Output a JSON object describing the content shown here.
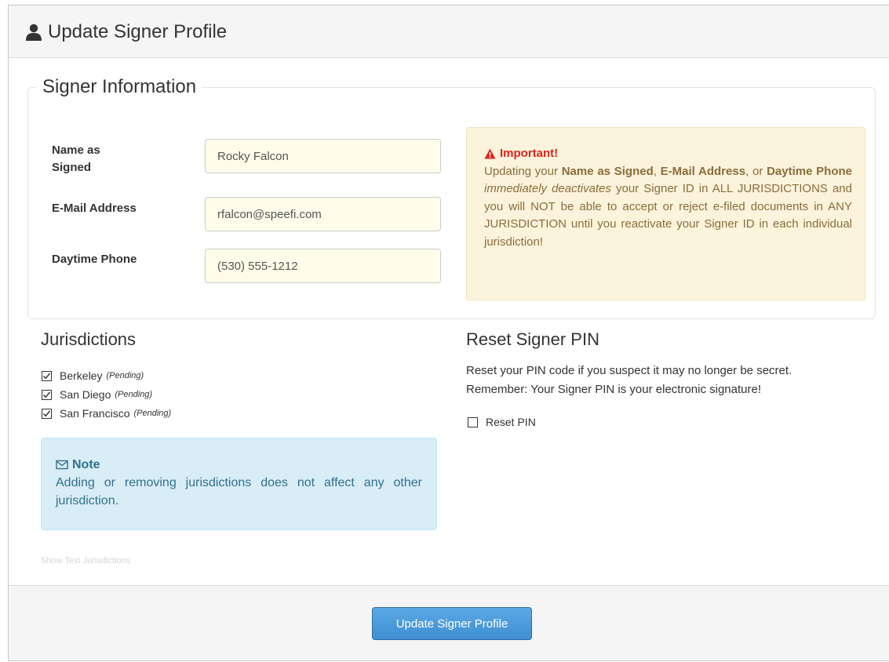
{
  "header": {
    "title": "Update Signer Profile",
    "icon": "user-icon"
  },
  "signer_info": {
    "legend": "Signer Information",
    "name": {
      "label_line1": "Name as",
      "label_line2": "Signed",
      "value": "Rocky Falcon"
    },
    "email": {
      "label": "E-Mail Address",
      "value": "rfalcon@speefi.com"
    },
    "phone": {
      "label": "Daytime Phone",
      "value": "(530) 555-1212"
    },
    "important": {
      "icon": "warning-icon",
      "title": "Important!",
      "p1": "Updating your ",
      "b1": "Name as Signed",
      "p2": ", ",
      "b2": "E-Mail Address",
      "p3": ", or ",
      "b3": "Daytime Phone",
      "p4": " ",
      "i1": "immediately deactivates",
      "p5": " your Signer ID in ALL JURISDICTIONS and you will NOT be able to accept or reject e-filed documents in ANY JURISDICTION until you reactivate your Signer ID in each individual jurisdiction!"
    }
  },
  "jurisdictions": {
    "title": "Jurisdictions",
    "items": [
      {
        "name": "Berkeley",
        "status": "(Pending)",
        "checked": true
      },
      {
        "name": "San Diego",
        "status": "(Pending)",
        "checked": true
      },
      {
        "name": "San Francisco",
        "status": "(Pending)",
        "checked": true
      }
    ],
    "note": {
      "icon": "envelope-icon",
      "title": "Note",
      "text": "Adding or removing jurisdictions does not affect any other jurisdiction."
    },
    "show_test_link": "Show Test Jurisdictions"
  },
  "reset_pin": {
    "title": "Reset Signer PIN",
    "line1": "Reset your PIN code if you suspect it may no longer be secret.",
    "line2": "Remember: Your Signer PIN is your electronic signature!",
    "checkbox_label": "Reset PIN",
    "checked": false
  },
  "footer": {
    "submit_label": "Update Signer Profile"
  },
  "colors": {
    "warning_bg": "#fcf3dc",
    "warning_text": "#8a6d3b",
    "warning_title": "#d9251c",
    "note_bg": "#d9edf7",
    "note_text": "#31708f",
    "input_bg": "#fffdea",
    "primary_button": "#3f8fd2"
  }
}
